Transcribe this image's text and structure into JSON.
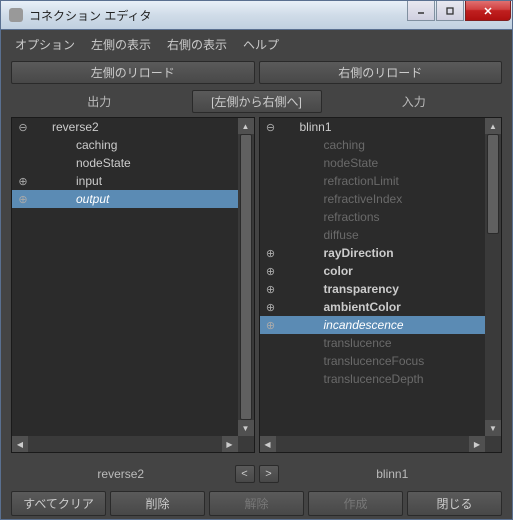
{
  "window": {
    "title": "コネクション エディタ"
  },
  "menu": {
    "options": "オプション",
    "left_display": "左側の表示",
    "right_display": "右側の表示",
    "help": "ヘルプ"
  },
  "reload": {
    "left": "左側のリロード",
    "right": "右側のリロード"
  },
  "columns": {
    "output": "出力",
    "direction": "[左側から右側へ]",
    "input": "入力"
  },
  "left_panel": {
    "node": "reverse2",
    "items": [
      {
        "label": "reverse2",
        "toggle": "minus",
        "indent": 0,
        "bold": false,
        "italic": false,
        "dim": false,
        "selected": false
      },
      {
        "label": "caching",
        "toggle": "none",
        "indent": 1,
        "bold": false,
        "italic": false,
        "dim": false,
        "selected": false
      },
      {
        "label": "nodeState",
        "toggle": "none",
        "indent": 1,
        "bold": false,
        "italic": false,
        "dim": false,
        "selected": false
      },
      {
        "label": "input",
        "toggle": "plus",
        "indent": 1,
        "bold": false,
        "italic": false,
        "dim": false,
        "selected": false
      },
      {
        "label": "output",
        "toggle": "plus",
        "indent": 1,
        "bold": false,
        "italic": true,
        "dim": false,
        "selected": true
      }
    ]
  },
  "right_panel": {
    "node": "blinn1",
    "items": [
      {
        "label": "blinn1",
        "toggle": "minus",
        "indent": 0,
        "bold": false,
        "italic": false,
        "dim": false,
        "selected": false
      },
      {
        "label": "caching",
        "toggle": "none",
        "indent": 1,
        "bold": false,
        "italic": false,
        "dim": true,
        "selected": false
      },
      {
        "label": "nodeState",
        "toggle": "none",
        "indent": 1,
        "bold": false,
        "italic": false,
        "dim": true,
        "selected": false
      },
      {
        "label": "refractionLimit",
        "toggle": "none",
        "indent": 1,
        "bold": false,
        "italic": false,
        "dim": true,
        "selected": false
      },
      {
        "label": "refractiveIndex",
        "toggle": "none",
        "indent": 1,
        "bold": false,
        "italic": false,
        "dim": true,
        "selected": false
      },
      {
        "label": "refractions",
        "toggle": "none",
        "indent": 1,
        "bold": false,
        "italic": false,
        "dim": true,
        "selected": false
      },
      {
        "label": "diffuse",
        "toggle": "none",
        "indent": 1,
        "bold": false,
        "italic": false,
        "dim": true,
        "selected": false
      },
      {
        "label": "rayDirection",
        "toggle": "plus",
        "indent": 1,
        "bold": true,
        "italic": false,
        "dim": false,
        "selected": false
      },
      {
        "label": "color",
        "toggle": "plus",
        "indent": 1,
        "bold": true,
        "italic": false,
        "dim": false,
        "selected": false
      },
      {
        "label": "transparency",
        "toggle": "plus",
        "indent": 1,
        "bold": true,
        "italic": false,
        "dim": false,
        "selected": false
      },
      {
        "label": "ambientColor",
        "toggle": "plus",
        "indent": 1,
        "bold": true,
        "italic": false,
        "dim": false,
        "selected": false
      },
      {
        "label": "incandescence",
        "toggle": "plus",
        "indent": 1,
        "bold": false,
        "italic": true,
        "dim": false,
        "selected": true
      },
      {
        "label": "translucence",
        "toggle": "none",
        "indent": 1,
        "bold": false,
        "italic": false,
        "dim": true,
        "selected": false
      },
      {
        "label": "translucenceFocus",
        "toggle": "none",
        "indent": 1,
        "bold": false,
        "italic": false,
        "dim": true,
        "selected": false
      },
      {
        "label": "translucenceDepth",
        "toggle": "none",
        "indent": 1,
        "bold": false,
        "italic": false,
        "dim": true,
        "selected": false
      }
    ]
  },
  "nav": {
    "prev": "<",
    "next": ">"
  },
  "buttons": {
    "clear_all": "すべてクリア",
    "remove": "削除",
    "break": "解除",
    "make": "作成",
    "close": "閉じる"
  }
}
